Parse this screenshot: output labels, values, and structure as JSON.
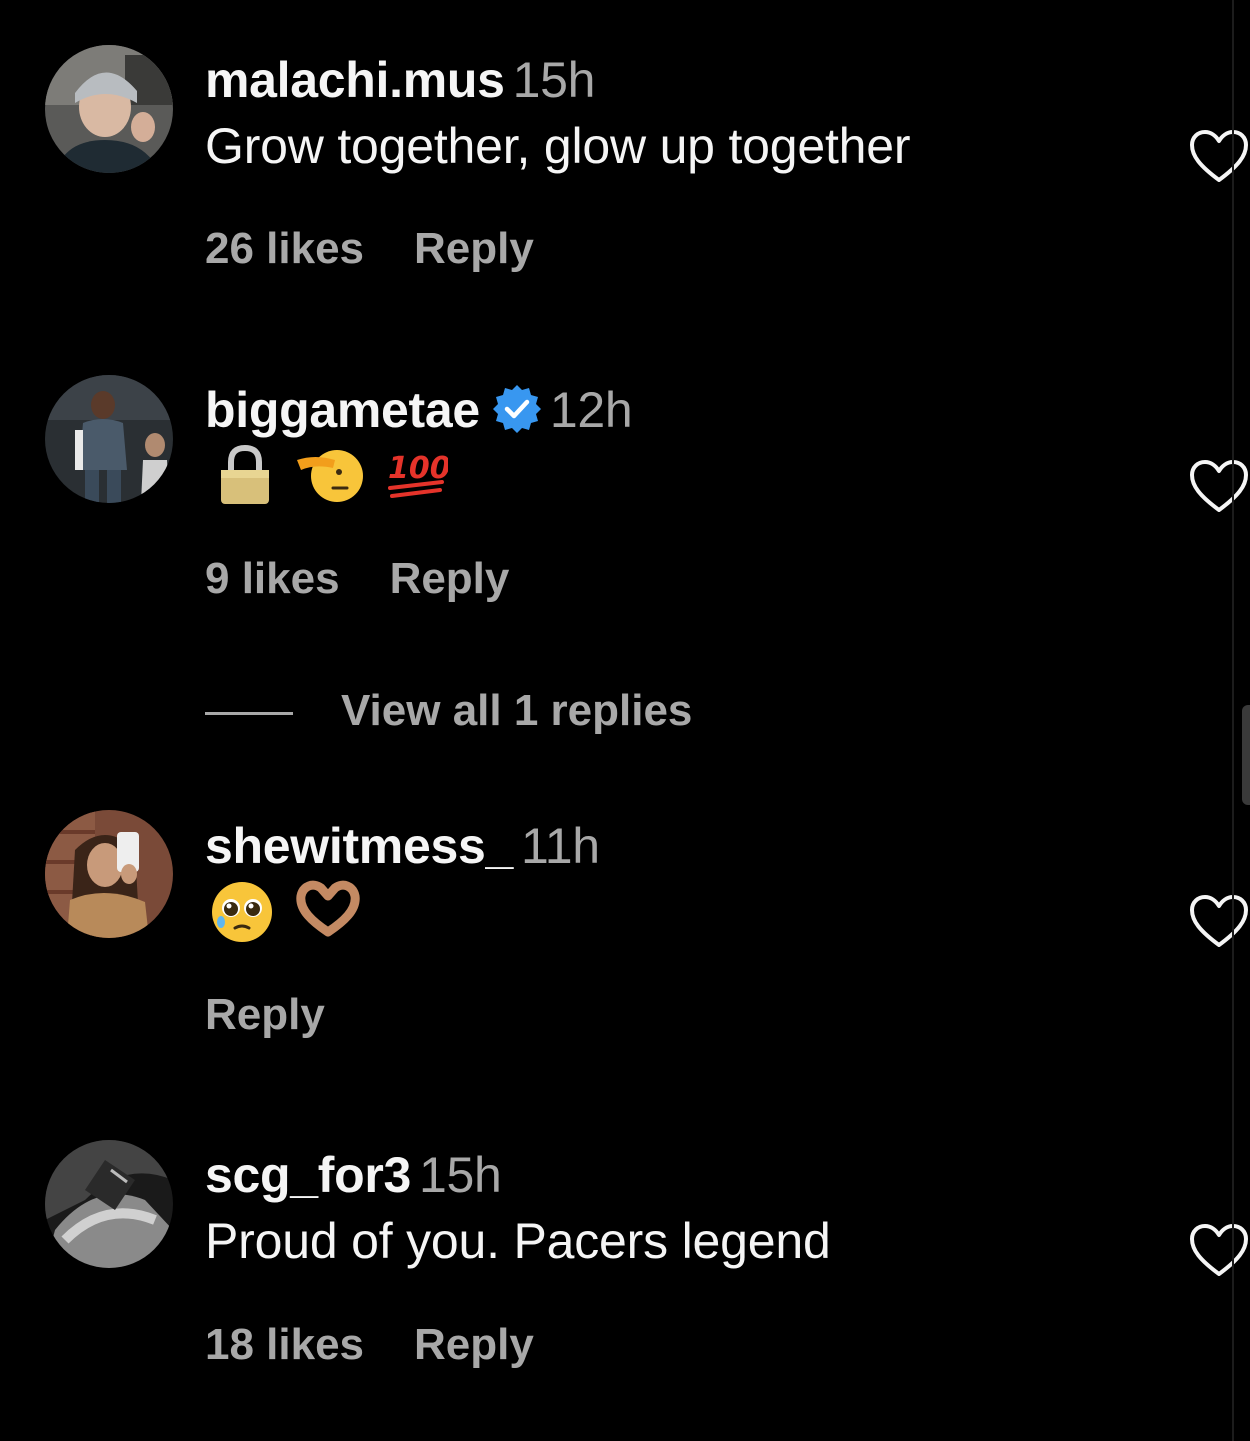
{
  "comments": [
    {
      "username": "malachi.mus",
      "time": "15h",
      "text": "Grow together, glow up together",
      "likes": "26 likes",
      "reply": "Reply"
    },
    {
      "username": "biggametae",
      "verified": true,
      "time": "12h",
      "emojis": [
        "lock",
        "saluting-face",
        "hundred-points"
      ],
      "likes": "9 likes",
      "reply": "Reply",
      "view_replies": "View all 1 replies"
    },
    {
      "username": "shewitmess_",
      "time": "11h",
      "emojis": [
        "pleading-face",
        "heart-hands"
      ],
      "reply": "Reply"
    },
    {
      "username": "scg_for3",
      "time": "15h",
      "text": "Proud of you. Pacers legend",
      "likes": "18 likes",
      "reply": "Reply"
    }
  ],
  "colors": {
    "background": "#000000",
    "primary_text": "#f5f5f5",
    "secondary_text": "#a8a8a8",
    "verified_badge": "#3897f0"
  }
}
